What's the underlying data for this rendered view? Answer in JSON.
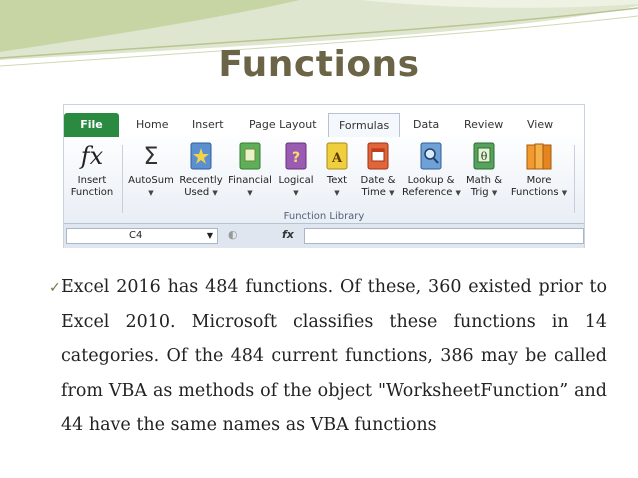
{
  "slide": {
    "title": "Functions"
  },
  "ribbon": {
    "tabs": {
      "file": "File",
      "home": "Home",
      "insert": "Insert",
      "page_layout": "Page Layout",
      "formulas": "Formulas",
      "data": "Data",
      "review": "Review",
      "view": "View"
    },
    "buttons": {
      "insert_function": [
        "Insert",
        "Function"
      ],
      "autosum": "AutoSum",
      "recently_used": [
        "Recently",
        "Used"
      ],
      "financial": "Financial",
      "logical": "Logical",
      "text": "Text",
      "date_time": [
        "Date &",
        "Time"
      ],
      "lookup_reference": [
        "Lookup &",
        "Reference"
      ],
      "math_trig": [
        "Math &",
        "Trig"
      ],
      "more_functions": [
        "More",
        "Functions"
      ]
    },
    "group_label": "Function Library",
    "formula_bar": {
      "name_box_value": "C4",
      "fx_label": "fx"
    },
    "colors": {
      "file_tab": "#2a8a3f",
      "title": "#6b6446"
    }
  },
  "body": {
    "bullet_icon": "checkmark-icon",
    "paragraph": "Excel 2016 has 484 functions. Of these, 360 existed prior to Excel 2010. Microsoft classifies these functions in 14 categories. Of the 484 current functions, 386 may be called from VBA as methods of the object \"WorksheetFunction” and 44 have the same names as VBA functions"
  }
}
